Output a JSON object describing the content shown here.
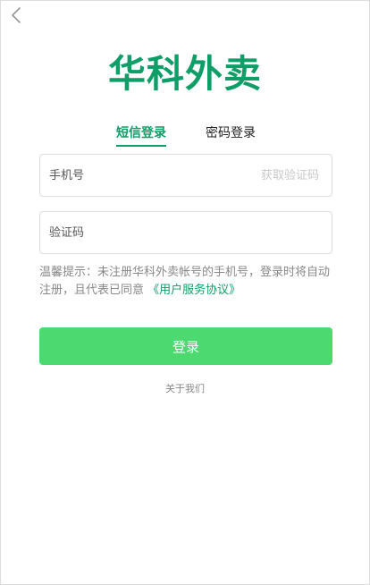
{
  "header": {
    "back_icon": "chevron-left-icon",
    "logo_text": "华科外卖"
  },
  "tabs": [
    {
      "label": "短信登录",
      "active": true
    },
    {
      "label": "密码登录",
      "active": false
    }
  ],
  "form": {
    "phone_placeholder": "手机号",
    "phone_value": "",
    "get_code_label": "获取验证码",
    "code_placeholder": "验证码",
    "code_value": ""
  },
  "notice": {
    "text": "温馨提示：未注册华科外卖帐号的手机号，登录时将自动注册，且代表已同意",
    "agreement_link": "《用户服务协议》"
  },
  "login_button_label": "登录",
  "about_link": "关于我们",
  "colors": {
    "brand_green": "#0f9d68",
    "button_green": "#4cd96f",
    "muted_text": "#888888",
    "placeholder_gray": "#c8c8c8",
    "border_gray": "#dddddd"
  }
}
